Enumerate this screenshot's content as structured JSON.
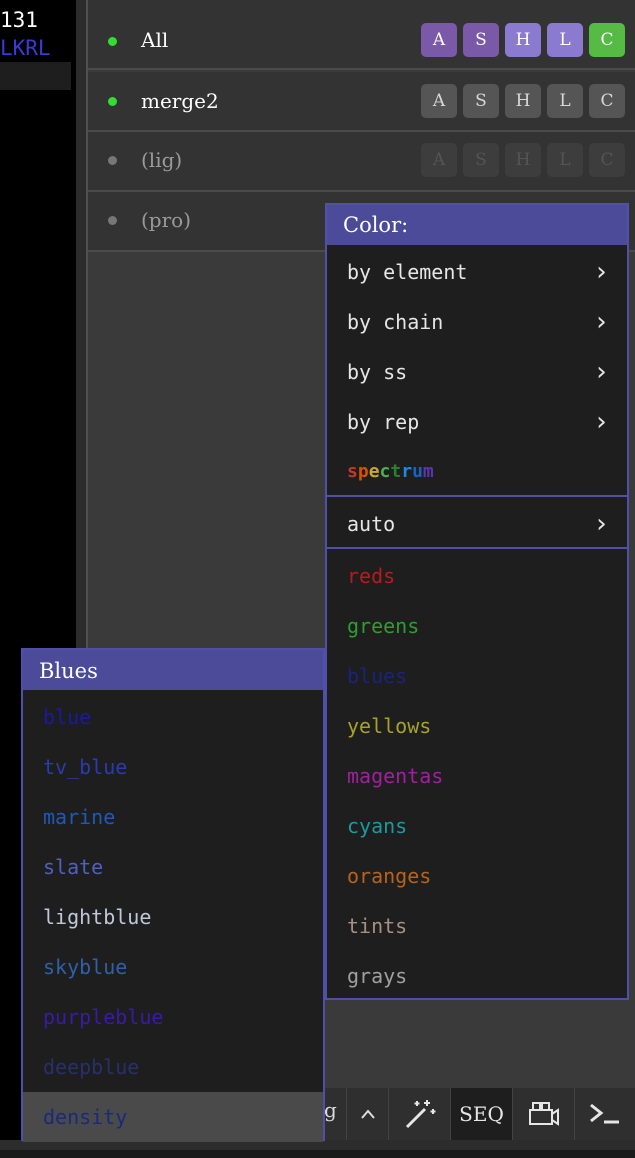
{
  "sequence": {
    "number": "131",
    "residues": "LKRL"
  },
  "objects": [
    {
      "name": "All",
      "enabled": true,
      "dot_color": "#33dd33",
      "text_color": "#ffffff",
      "buttons": [
        {
          "label": "A",
          "bg": "#7a5aa8",
          "fg": "#ffffff"
        },
        {
          "label": "S",
          "bg": "#7a5aa8",
          "fg": "#ffffff"
        },
        {
          "label": "H",
          "bg": "#8a7ad0",
          "fg": "#ffffff"
        },
        {
          "label": "L",
          "bg": "#8a7ad0",
          "fg": "#ffffff"
        },
        {
          "label": "C",
          "bg": "#55bb44",
          "fg": "#ffffff"
        }
      ]
    },
    {
      "name": "merge2",
      "enabled": true,
      "dot_color": "#33dd33",
      "text_color": "#ffffff",
      "buttons": [
        {
          "label": "A",
          "bg": "#555555",
          "fg": "#d8d8d8"
        },
        {
          "label": "S",
          "bg": "#555555",
          "fg": "#d8d8d8"
        },
        {
          "label": "H",
          "bg": "#555555",
          "fg": "#d8d8d8"
        },
        {
          "label": "L",
          "bg": "#555555",
          "fg": "#d8d8d8"
        },
        {
          "label": "C",
          "bg": "#555555",
          "fg": "#d8d8d8"
        }
      ]
    },
    {
      "name": "(lig)",
      "enabled": false,
      "dot_color": "#777777",
      "text_color": "#9a9a9a",
      "buttons": [
        {
          "label": "A",
          "bg": "#3d3d3d",
          "fg": "#555555"
        },
        {
          "label": "S",
          "bg": "#3d3d3d",
          "fg": "#555555"
        },
        {
          "label": "H",
          "bg": "#3d3d3d",
          "fg": "#555555"
        },
        {
          "label": "L",
          "bg": "#3d3d3d",
          "fg": "#555555"
        },
        {
          "label": "C",
          "bg": "#3d3d3d",
          "fg": "#555555"
        }
      ]
    },
    {
      "name": "(pro)",
      "enabled": false,
      "dot_color": "#777777",
      "text_color": "#9a9a9a",
      "buttons": []
    }
  ],
  "color_menu": {
    "title": "Color:",
    "items": [
      {
        "label": "by element",
        "submenu": true
      },
      {
        "label": "by chain",
        "submenu": true
      },
      {
        "label": "by ss",
        "submenu": true
      },
      {
        "label": "by rep",
        "submenu": true
      }
    ],
    "spectrum": {
      "label": "spectrum",
      "letter_colors": [
        "#c0392b",
        "#d35400",
        "#c7a82a",
        "#4caf50",
        "#2e7d32",
        "#1e88e5",
        "#1565c0",
        "#5e35b1"
      ]
    },
    "auto": {
      "label": "auto",
      "submenu": true
    },
    "groups": [
      {
        "label": "reds",
        "color": "#b71c1c"
      },
      {
        "label": "greens",
        "color": "#2e9e2e"
      },
      {
        "label": "blues",
        "color": "#1a237e"
      },
      {
        "label": "yellows",
        "color": "#a8a22a"
      },
      {
        "label": "magentas",
        "color": "#a020a0"
      },
      {
        "label": "cyans",
        "color": "#1a9aa0"
      },
      {
        "label": "oranges",
        "color": "#b8621b"
      },
      {
        "label": "tints",
        "color": "#a89080"
      },
      {
        "label": "grays",
        "color": "#a0a0a0"
      }
    ]
  },
  "blues_menu": {
    "title": "Blues",
    "items": [
      {
        "label": "blue",
        "color": "#1a1aa0"
      },
      {
        "label": "tv_blue",
        "color": "#2a3ab0"
      },
      {
        "label": "marine",
        "color": "#2058b8"
      },
      {
        "label": "slate",
        "color": "#5060c0"
      },
      {
        "label": "lightblue",
        "color": "#c0c8d8"
      },
      {
        "label": "skyblue",
        "color": "#3060a8"
      },
      {
        "label": "purpleblue",
        "color": "#3a1aa8"
      },
      {
        "label": "deepblue",
        "color": "#28306a"
      },
      {
        "label": "density",
        "color": "#1a2a7a",
        "hover": true
      }
    ]
  },
  "toolbar": {
    "partial_label": "g",
    "buttons": [
      {
        "name": "chevron-up-icon",
        "label": "^"
      },
      {
        "name": "magic-wand-icon"
      },
      {
        "name": "seq-button",
        "label": "SEQ"
      },
      {
        "name": "movie-camera-icon"
      },
      {
        "name": "terminal-icon",
        "label": ">_"
      }
    ]
  }
}
